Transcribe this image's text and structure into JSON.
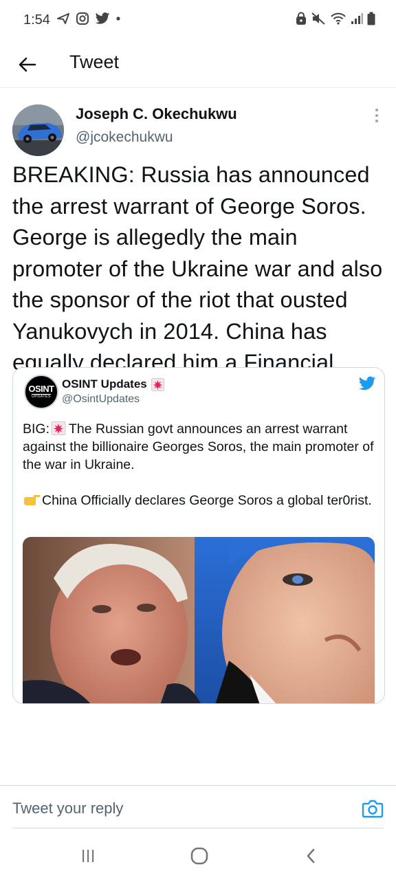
{
  "status_bar": {
    "time": "1:54",
    "left_icons": [
      "send-icon",
      "instagram-icon",
      "twitter-icon",
      "dot-icon"
    ],
    "right_icons": [
      "lock-icon",
      "mute-icon",
      "wifi-icon",
      "signal-icon",
      "battery-icon"
    ]
  },
  "header": {
    "title": "Tweet",
    "back_icon": "arrow-left-icon"
  },
  "tweet": {
    "author_name": "Joseph C. Okechukwu",
    "author_handle": "@jcokechukwu",
    "text": "BREAKING: Russia has announced the arrest warrant of George Soros. George is allegedly the main promoter of the Ukraine war and also the sponsor of the riot that ousted Yanukovych in 2014. China has equally declared him a Financial Terrorist. So, both countries ask for his head.",
    "more_icon": "more-vertical-icon"
  },
  "quote": {
    "avatar_line1": "OSINT",
    "avatar_line2": "UPDATES",
    "author_name": "OSINT Updates",
    "author_handle": "@OsintUpdates",
    "para1_prefix": "BIG:",
    "para1_body": "The Russian govt announces an arrest warrant against the billionaire Georges Soros, the main promoter of the war in Ukraine.",
    "para2": "China Officially declares George Soros a global ter0rist.",
    "brand_color": "#1d9bf0",
    "siren_color": "#e0245e"
  },
  "reply": {
    "placeholder": "Tweet your reply",
    "camera_icon": "camera-icon"
  },
  "nav": {
    "recents_icon": "recents-icon",
    "home_icon": "home-circle-icon",
    "back_icon": "chevron-left-icon"
  }
}
